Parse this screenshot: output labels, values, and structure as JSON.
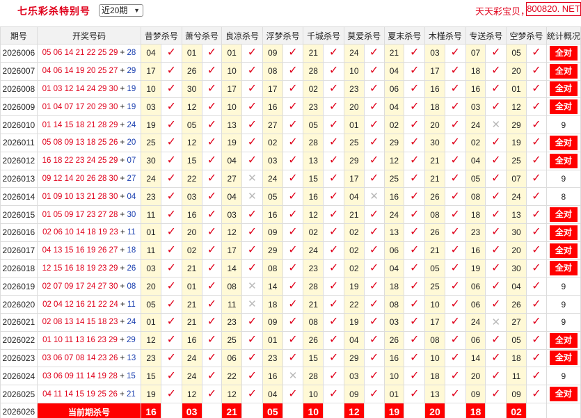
{
  "header": {
    "title": "七乐彩杀特别号",
    "period_select": "近20期",
    "site_text": "天天彩宝贝，",
    "site_url": "800820. NET"
  },
  "columns": {
    "issue": "期号",
    "draw": "开奖号码",
    "experts": [
      "昔梦杀号",
      "萧兮杀号",
      "良凉杀号",
      "浮梦杀号",
      "千城杀号",
      "莫爱杀号",
      "夏末杀号",
      "木槿杀号",
      "专送杀号",
      "空梦杀号"
    ],
    "stat": "统计概况"
  },
  "rows": [
    {
      "issue": "2026006",
      "nums": "05 06 14 21 22 25 29",
      "sp": "28",
      "kills": [
        "04",
        "01",
        "01",
        "09",
        "21",
        "24",
        "21",
        "03",
        "07",
        "05"
      ],
      "hits": [
        1,
        1,
        1,
        1,
        1,
        1,
        1,
        1,
        1,
        1
      ],
      "stat": "全对"
    },
    {
      "issue": "2026007",
      "nums": "04 06 14 19 20 25 27",
      "sp": "29",
      "kills": [
        "17",
        "26",
        "10",
        "08",
        "28",
        "10",
        "04",
        "17",
        "18",
        "20"
      ],
      "hits": [
        1,
        1,
        1,
        1,
        1,
        1,
        1,
        1,
        1,
        1
      ],
      "stat": "全对"
    },
    {
      "issue": "2026008",
      "nums": "01 03 12 14 24 29 30",
      "sp": "19",
      "kills": [
        "10",
        "30",
        "17",
        "17",
        "02",
        "23",
        "06",
        "16",
        "16",
        "01"
      ],
      "hits": [
        1,
        1,
        1,
        1,
        1,
        1,
        1,
        1,
        1,
        1
      ],
      "stat": "全对"
    },
    {
      "issue": "2026009",
      "nums": "01 04 07 17 20 29 30",
      "sp": "19",
      "kills": [
        "03",
        "12",
        "10",
        "16",
        "23",
        "20",
        "04",
        "18",
        "03",
        "12"
      ],
      "hits": [
        1,
        1,
        1,
        1,
        1,
        1,
        1,
        1,
        1,
        1
      ],
      "stat": "全对"
    },
    {
      "issue": "2026010",
      "nums": "01 14 15 18 21 28 29",
      "sp": "24",
      "kills": [
        "19",
        "05",
        "13",
        "27",
        "05",
        "01",
        "02",
        "20",
        "24",
        "29"
      ],
      "hits": [
        1,
        1,
        1,
        1,
        1,
        1,
        1,
        1,
        0,
        1
      ],
      "stat": "9"
    },
    {
      "issue": "2026011",
      "nums": "05 08 09 13 18 25 26",
      "sp": "20",
      "kills": [
        "25",
        "12",
        "19",
        "02",
        "28",
        "25",
        "29",
        "30",
        "02",
        "19"
      ],
      "hits": [
        1,
        1,
        1,
        1,
        1,
        1,
        1,
        1,
        1,
        1
      ],
      "stat": "全对"
    },
    {
      "issue": "2026012",
      "nums": "16 18 22 23 24 25 29",
      "sp": "07",
      "kills": [
        "30",
        "15",
        "04",
        "03",
        "13",
        "29",
        "12",
        "21",
        "04",
        "25"
      ],
      "hits": [
        1,
        1,
        1,
        1,
        1,
        1,
        1,
        1,
        1,
        1
      ],
      "stat": "全对"
    },
    {
      "issue": "2026013",
      "nums": "09 12 14 20 26 28 30",
      "sp": "27",
      "kills": [
        "24",
        "22",
        "27",
        "24",
        "15",
        "17",
        "25",
        "21",
        "05",
        "07"
      ],
      "hits": [
        1,
        1,
        0,
        1,
        1,
        1,
        1,
        1,
        1,
        1
      ],
      "stat": "9"
    },
    {
      "issue": "2026014",
      "nums": "01 09 10 13 21 28 30",
      "sp": "04",
      "kills": [
        "23",
        "03",
        "04",
        "05",
        "16",
        "04",
        "16",
        "26",
        "08",
        "24"
      ],
      "hits": [
        1,
        1,
        0,
        1,
        1,
        0,
        1,
        1,
        1,
        1
      ],
      "stat": "8"
    },
    {
      "issue": "2026015",
      "nums": "01 05 09 17 23 27 28",
      "sp": "30",
      "kills": [
        "11",
        "16",
        "03",
        "16",
        "12",
        "21",
        "24",
        "08",
        "18",
        "13"
      ],
      "hits": [
        1,
        1,
        1,
        1,
        1,
        1,
        1,
        1,
        1,
        1
      ],
      "stat": "全对"
    },
    {
      "issue": "2026016",
      "nums": "02 06 10 14 18 19 23",
      "sp": "11",
      "kills": [
        "01",
        "20",
        "12",
        "09",
        "02",
        "02",
        "13",
        "26",
        "23",
        "30"
      ],
      "hits": [
        1,
        1,
        1,
        1,
        1,
        1,
        1,
        1,
        1,
        1
      ],
      "stat": "全对"
    },
    {
      "issue": "2026017",
      "nums": "04 13 15 16 19 26 27",
      "sp": "18",
      "kills": [
        "11",
        "02",
        "17",
        "29",
        "24",
        "02",
        "06",
        "21",
        "16",
        "20"
      ],
      "hits": [
        1,
        1,
        1,
        1,
        1,
        1,
        1,
        1,
        1,
        1
      ],
      "stat": "全对"
    },
    {
      "issue": "2026018",
      "nums": "12 15 16 18 19 23 29",
      "sp": "26",
      "kills": [
        "03",
        "21",
        "14",
        "08",
        "23",
        "02",
        "04",
        "05",
        "19",
        "30"
      ],
      "hits": [
        1,
        1,
        1,
        1,
        1,
        1,
        1,
        1,
        1,
        1
      ],
      "stat": "全对"
    },
    {
      "issue": "2026019",
      "nums": "02 07 09 17 24 27 30",
      "sp": "08",
      "kills": [
        "20",
        "01",
        "08",
        "14",
        "28",
        "19",
        "18",
        "25",
        "06",
        "04"
      ],
      "hits": [
        1,
        1,
        0,
        1,
        1,
        1,
        1,
        1,
        1,
        1
      ],
      "stat": "9"
    },
    {
      "issue": "2026020",
      "nums": "02 04 12 16 21 22 24",
      "sp": "11",
      "kills": [
        "05",
        "21",
        "11",
        "18",
        "21",
        "22",
        "08",
        "10",
        "06",
        "26"
      ],
      "hits": [
        1,
        1,
        0,
        1,
        1,
        1,
        1,
        1,
        1,
        1
      ],
      "stat": "9"
    },
    {
      "issue": "2026021",
      "nums": "02 08 13 14 15 18 23",
      "sp": "24",
      "kills": [
        "01",
        "21",
        "23",
        "09",
        "08",
        "19",
        "03",
        "17",
        "24",
        "27"
      ],
      "hits": [
        1,
        1,
        1,
        1,
        1,
        1,
        1,
        1,
        0,
        1
      ],
      "stat": "9"
    },
    {
      "issue": "2026022",
      "nums": "01 10 11 13 16 23 29",
      "sp": "29",
      "kills": [
        "12",
        "16",
        "25",
        "01",
        "26",
        "04",
        "26",
        "08",
        "06",
        "05"
      ],
      "hits": [
        1,
        1,
        1,
        1,
        1,
        1,
        1,
        1,
        1,
        1
      ],
      "stat": "全对"
    },
    {
      "issue": "2026023",
      "nums": "03 06 07 08 14 23 26",
      "sp": "13",
      "kills": [
        "23",
        "24",
        "06",
        "23",
        "15",
        "29",
        "16",
        "10",
        "14",
        "18"
      ],
      "hits": [
        1,
        1,
        1,
        1,
        1,
        1,
        1,
        1,
        1,
        1
      ],
      "stat": "全对"
    },
    {
      "issue": "2026024",
      "nums": "03 06 09 11 14 19 28",
      "sp": "15",
      "kills": [
        "15",
        "24",
        "22",
        "16",
        "28",
        "03",
        "10",
        "18",
        "20",
        "11"
      ],
      "hits": [
        1,
        1,
        1,
        0,
        1,
        1,
        1,
        1,
        1,
        1
      ],
      "stat": "9"
    },
    {
      "issue": "2026025",
      "nums": "04 11 14 15 19 25 26",
      "sp": "21",
      "kills": [
        "19",
        "12",
        "12",
        "04",
        "10",
        "09",
        "01",
        "13",
        "09",
        "09"
      ],
      "hits": [
        1,
        1,
        1,
        1,
        1,
        1,
        1,
        1,
        1,
        1
      ],
      "stat": "全对"
    }
  ],
  "current": {
    "issue": "2026026",
    "label": "当前期杀号",
    "kills": [
      "16",
      "03",
      "21",
      "05",
      "10",
      "12",
      "19",
      "20",
      "18",
      "02"
    ]
  },
  "colors": {
    "accent": "#e0001b",
    "kill_bg": "#fff9d6",
    "header_bg": "#f2f2f2",
    "special_blue": "#1a3fb0",
    "all_hit_bg": "#ff0000"
  },
  "icons": {
    "hit": "check-icon",
    "miss": "cross-icon",
    "dropdown": "chevron-down-icon"
  }
}
